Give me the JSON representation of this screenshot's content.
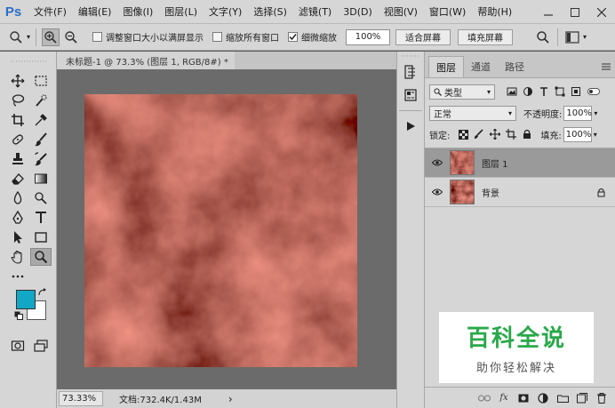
{
  "app": {
    "logo": "Ps"
  },
  "menu": [
    "文件(F)",
    "编辑(E)",
    "图像(I)",
    "图层(L)",
    "文字(Y)",
    "选择(S)",
    "滤镜(T)",
    "3D(D)",
    "视图(V)",
    "窗口(W)",
    "帮助(H)"
  ],
  "options": {
    "resize_windows_label": "调整窗口大小以满屏显示",
    "resize_windows_checked": false,
    "zoom_all_label": "缩放所有窗口",
    "zoom_all_checked": false,
    "scrubby_zoom_label": "细微缩放",
    "scrubby_zoom_checked": true,
    "zoom_value": "100%",
    "fit_screen_label": "适合屏幕",
    "fill_screen_label": "填充屏幕"
  },
  "document": {
    "tab_title": "未标题-1 @ 73.3% (图层 1, RGB/8#) *",
    "close_glyph": "×",
    "status_zoom": "73.33%",
    "status_info": "文档:732.4K/1.43M",
    "status_arrow": "›"
  },
  "colors": {
    "foreground": "#12a7c4",
    "background": "#ffffff",
    "cloud_base": "#8a2a1e"
  },
  "layers_panel": {
    "tabs": [
      "图层",
      "通道",
      "路径"
    ],
    "active_tab": 0,
    "filter_label": "类型",
    "blend_mode": "正常",
    "opacity_label": "不透明度:",
    "opacity_value": "100%",
    "lock_label": "锁定:",
    "fill_label": "填充:",
    "fill_value": "100%",
    "layers": [
      {
        "name": "图层 1",
        "selected": true,
        "locked": false
      },
      {
        "name": "背景",
        "selected": false,
        "locked": true
      }
    ],
    "bottom_icons": [
      "link-icon",
      "fx-icon",
      "mask-icon",
      "adjustment-icon",
      "group-icon",
      "new-layer-icon",
      "trash-icon"
    ],
    "fx_label": "fx"
  },
  "watermark": {
    "title": "百科全说",
    "subtitle": "助你轻松解决"
  }
}
